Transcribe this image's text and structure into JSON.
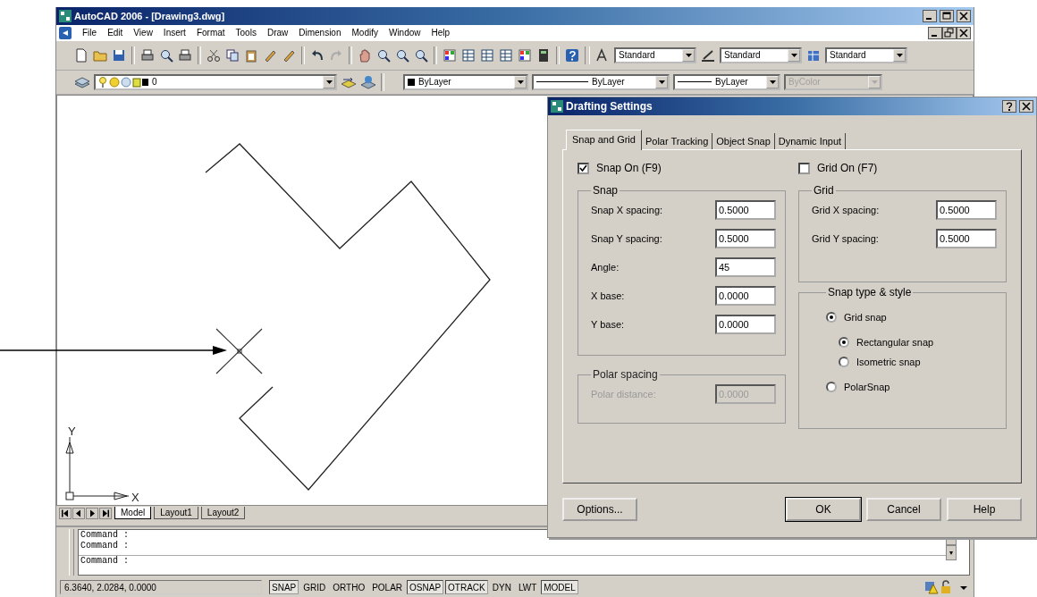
{
  "window": {
    "title": "AutoCAD 2006 - [Drawing3.dwg]"
  },
  "menu": [
    "File",
    "Edit",
    "View",
    "Insert",
    "Format",
    "Tools",
    "Draw",
    "Dimension",
    "Modify",
    "Window",
    "Help"
  ],
  "styles": [
    {
      "value": "Standard"
    },
    {
      "value": "Standard"
    },
    {
      "value": "Standard"
    }
  ],
  "properties": {
    "layer": "0",
    "color_control": "ByLayer",
    "linetype": "ByLayer",
    "lineweight": "ByLayer",
    "plot_style": {
      "value": "ByColor",
      "disabled": true
    }
  },
  "canvas": {
    "axis_x": "X",
    "axis_y": "Y"
  },
  "layout_tabs": [
    {
      "label": "Model",
      "selected": true
    },
    {
      "label": "Layout1",
      "selected": false
    },
    {
      "label": "Layout2",
      "selected": false
    }
  ],
  "command_lines": [
    "Command :",
    "Command :",
    "Command :"
  ],
  "status_bar": {
    "coordinates": "6.3640, 2.0284, 0.0000",
    "toggles": [
      {
        "label": "SNAP",
        "on": true
      },
      {
        "label": "GRID",
        "on": false
      },
      {
        "label": "ORTHO",
        "on": false
      },
      {
        "label": "POLAR",
        "on": false
      },
      {
        "label": "OSNAP",
        "on": true
      },
      {
        "label": "OTRACK",
        "on": true
      },
      {
        "label": "DYN",
        "on": false
      },
      {
        "label": "LWT",
        "on": false
      },
      {
        "label": "MODEL",
        "on": true
      }
    ]
  },
  "dialog": {
    "title": "Drafting Settings",
    "tabs": [
      {
        "label": "Snap and Grid",
        "selected": true
      },
      {
        "label": "Polar Tracking",
        "selected": false
      },
      {
        "label": "Object Snap",
        "selected": false
      },
      {
        "label": "Dynamic Input",
        "selected": false
      }
    ],
    "snap_on": {
      "label": "Snap On (F9)",
      "checked": true
    },
    "grid_on": {
      "label": "Grid On (F7)",
      "checked": false
    },
    "snap_group": {
      "title": "Snap",
      "fields": [
        {
          "label": "Snap X spacing:",
          "value": "0.5000"
        },
        {
          "label": "Snap Y spacing:",
          "value": "0.5000"
        },
        {
          "label": "Angle:",
          "value": "45"
        },
        {
          "label": "X base:",
          "value": "0.0000"
        },
        {
          "label": "Y base:",
          "value": "0.0000"
        }
      ]
    },
    "polar_group": {
      "title": "Polar spacing",
      "field": {
        "label": "Polar distance:",
        "value": "0.0000",
        "disabled": true
      }
    },
    "grid_group": {
      "title": "Grid",
      "fields": [
        {
          "label": "Grid X spacing:",
          "value": "0.5000"
        },
        {
          "label": "Grid Y spacing:",
          "value": "0.5000"
        }
      ]
    },
    "snap_type_group": {
      "title": "Snap type & style",
      "options": [
        {
          "label": "Grid snap",
          "selected": true,
          "children": [
            {
              "label": "Rectangular snap",
              "selected": true
            },
            {
              "label": "Isometric snap",
              "selected": false
            }
          ]
        },
        {
          "label": "PolarSnap",
          "selected": false
        }
      ]
    },
    "buttons": [
      {
        "label": "Options...",
        "kind": "left"
      },
      {
        "label": "OK",
        "kind": "default"
      },
      {
        "label": "Cancel",
        "kind": "normal"
      },
      {
        "label": "Help",
        "kind": "normal"
      }
    ]
  }
}
